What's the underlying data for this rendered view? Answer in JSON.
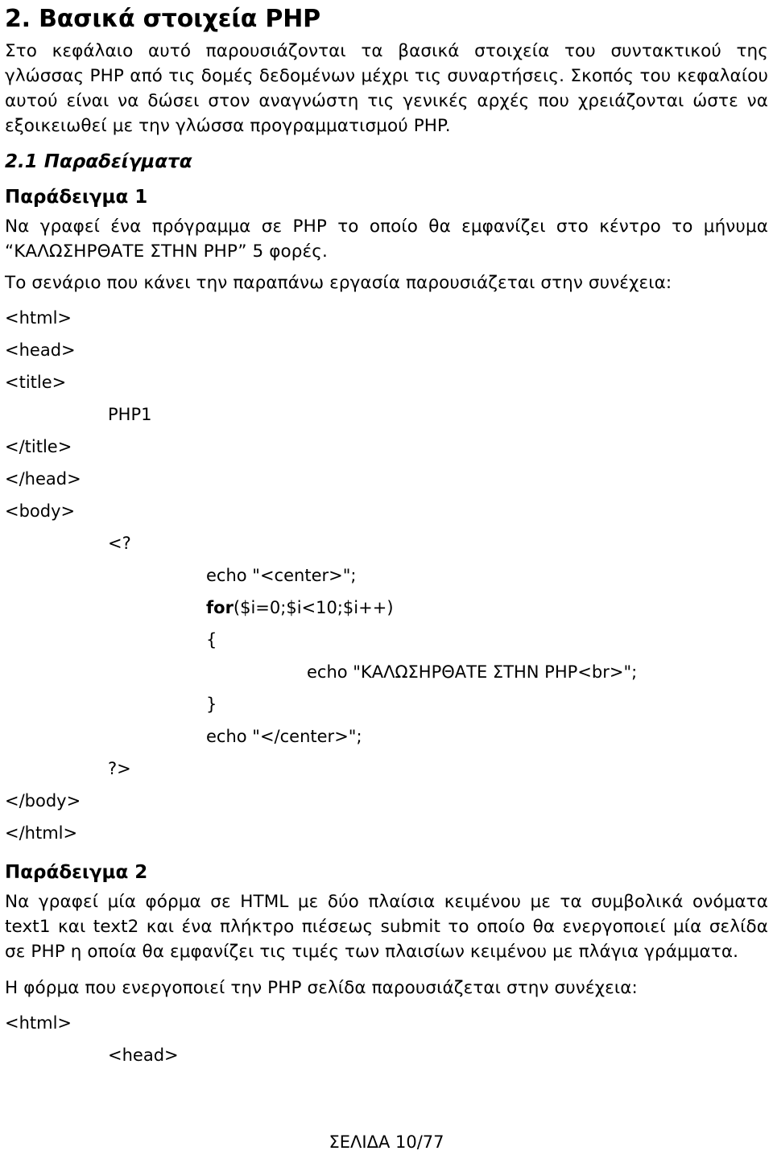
{
  "document": {
    "chapter_heading": "2. Βασικά στοιχεία PHP",
    "intro_paragraph": "Στο κεφάλαιο αυτό παρουσιάζονται τα βασικά στοιχεία του συντακτικού της γλώσσας PHP από τις δομές δεδομένων μέχρι τις συναρτήσεις. Σκοπός του κεφαλαίου αυτού είναι να δώσει στον αναγνώστη τις γενικές αρχές που χρειάζονται ώστε να εξοικειωθεί με την γλώσσα προγραμματισμού PHP.",
    "section_heading": "2.1 Παραδείγματα",
    "example1": {
      "heading": "Παράδειγμα 1",
      "statement": "Να γραφεί ένα πρόγραμμα σε PHP το οποίο θα εμφανίζει στο κέντρο  το μήνυμα “ΚΑΛΩΣΗΡΘΑΤΕ ΣΤΗΝ PHP” 5 φορές.",
      "lead_in": "Το σενάριο που κάνει την παραπάνω εργασία παρουσιάζεται στην συνέχεια:",
      "code_lines": [
        {
          "indent": 0,
          "text": "<html>"
        },
        {
          "indent": 0,
          "text": "<head>"
        },
        {
          "indent": 0,
          "text": "<title>"
        },
        {
          "indent": 128,
          "text": "PHP1"
        },
        {
          "indent": 0,
          "text": "</title>"
        },
        {
          "indent": 0,
          "text": "</head>"
        },
        {
          "indent": 0,
          "text": "<body>"
        },
        {
          "indent": 128,
          "text": "<?"
        },
        {
          "indent": 250,
          "text": "echo \"<center>\";"
        },
        {
          "indent": 250,
          "text": "for($i=0;$i<10;$i++)",
          "bold_prefix": "for"
        },
        {
          "indent": 250,
          "text": "{"
        },
        {
          "indent": 375,
          "text": "echo \"ΚΑΛΩΣΗΡΘΑΤΕ ΣΤΗΝ PHP<br>\";"
        },
        {
          "indent": 250,
          "text": "}"
        },
        {
          "indent": 250,
          "text": "echo \"</center>\";"
        },
        {
          "indent": 128,
          "text": "?>"
        },
        {
          "indent": 0,
          "text": "</body>"
        },
        {
          "indent": 0,
          "text": "</html>"
        }
      ]
    },
    "example2": {
      "heading": "Παράδειγμα 2",
      "statement": "Να γραφεί μία φόρμα σε HTML με δύο πλαίσια κειμένου με τα συμβολικά ονόματα text1 και text2 και ένα πλήκτρο πιέσεως submit το οποίο θα ενεργοποιεί μία σελίδα σε PHP η οποία θα εμφανίζει τις τιμές των πλαισίων κειμένου με πλάγια γράμματα.",
      "lead_in": "Η φόρμα που ενεργοποιεί την PHP σελίδα παρουσιάζεται στην συνέχεια:",
      "code_lines": [
        {
          "indent": 0,
          "text": "<html>"
        },
        {
          "indent": 128,
          "text": "<head>"
        }
      ]
    },
    "footer": "ΣΕΛΙΔΑ 10/77"
  }
}
